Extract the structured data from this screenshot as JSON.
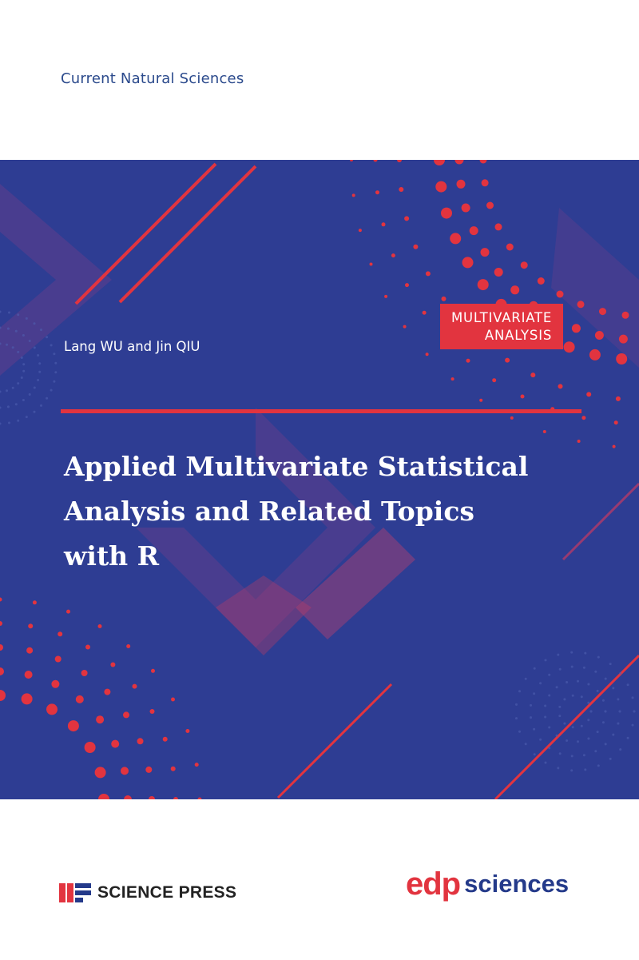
{
  "series": "Current Natural Sciences",
  "topic_badge": {
    "line1": "MULTIVARIATE",
    "line2": "ANALYSIS"
  },
  "authors": "Lang WU and Jin QIU",
  "title_lines": [
    "Applied Multivariate Statistical",
    "Analysis and Related Topics",
    "with R"
  ],
  "publishers": {
    "left": {
      "name": "SCIENCE PRESS",
      "logo_icon": "science-press-logo-icon"
    },
    "right": {
      "mark": "edp",
      "name": "sciences"
    }
  },
  "colors": {
    "panel_blue": "#2e3d93",
    "accent_red": "#e2343f",
    "series_blue": "#2b4a8c"
  }
}
